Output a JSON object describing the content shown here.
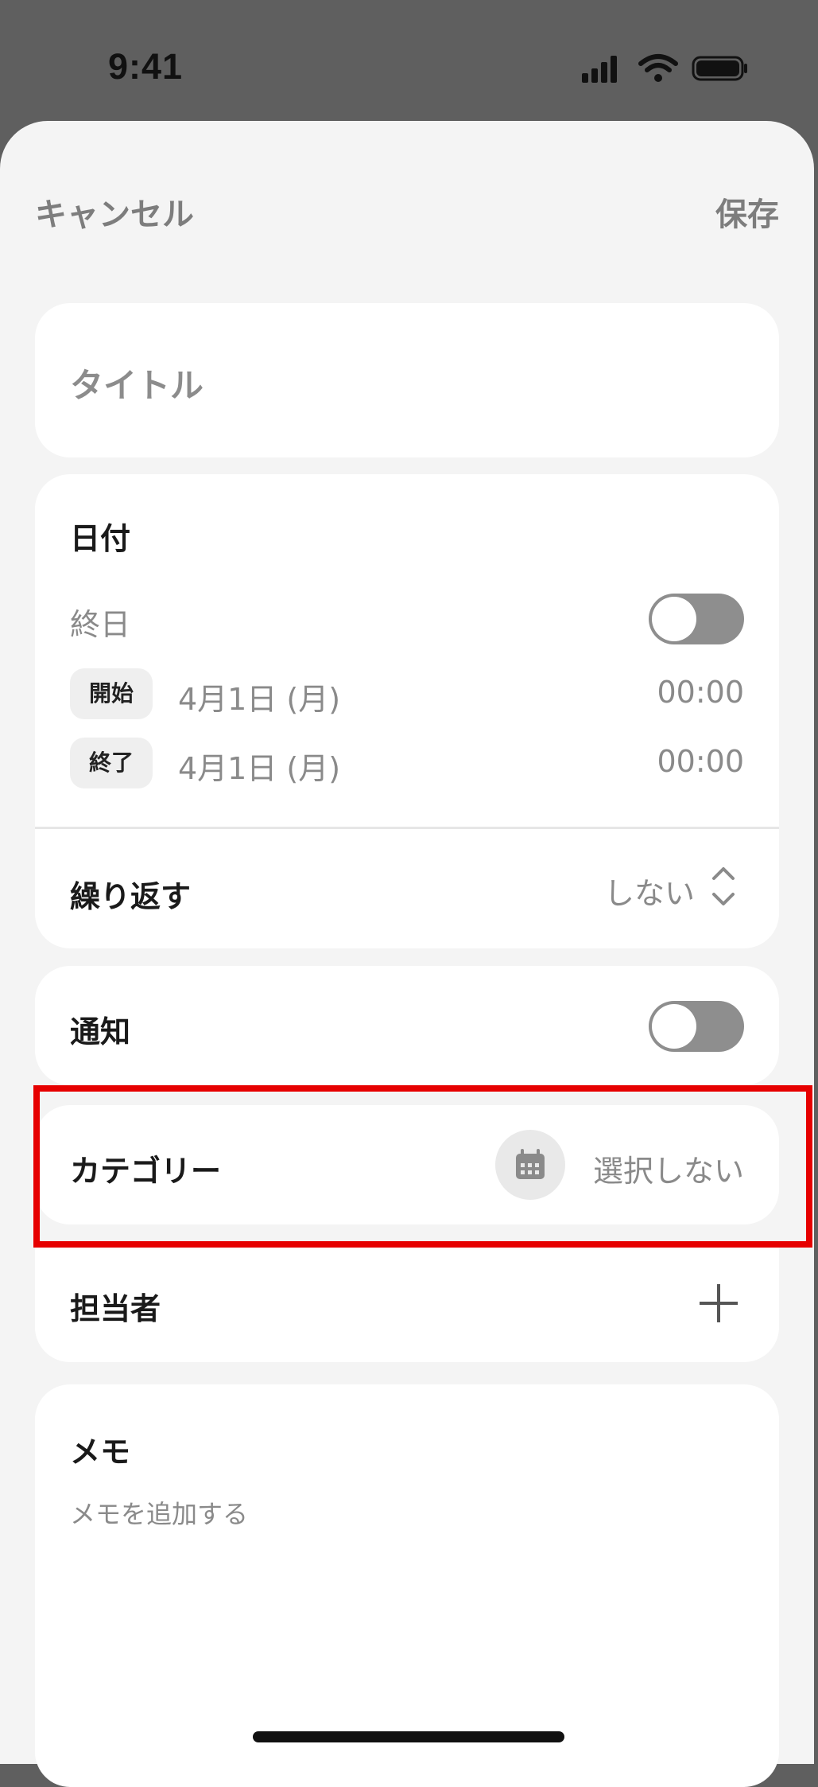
{
  "status_bar": {
    "time": "9:41"
  },
  "nav": {
    "cancel_label": "キャンセル",
    "save_label": "保存"
  },
  "title_field": {
    "placeholder": "タイトル",
    "value": ""
  },
  "date_section": {
    "heading": "日付",
    "all_day_label": "終日",
    "all_day_on": false,
    "start": {
      "chip": "開始",
      "date": "4月1日 (月)",
      "time": "00:00"
    },
    "end": {
      "chip": "終了",
      "date": "4月1日 (月)",
      "time": "00:00"
    },
    "repeat_label": "繰り返す",
    "repeat_value": "しない"
  },
  "notification": {
    "label": "通知",
    "on": false
  },
  "category": {
    "label": "カテゴリー",
    "icon": "calendar-icon",
    "value": "選択しない"
  },
  "assignee": {
    "label": "担当者",
    "icon": "plus-icon"
  },
  "memo": {
    "heading": "メモ",
    "placeholder": "メモを追加する"
  },
  "colors": {
    "highlight": "#e60000",
    "toggle_off": "#8e8e8e"
  }
}
